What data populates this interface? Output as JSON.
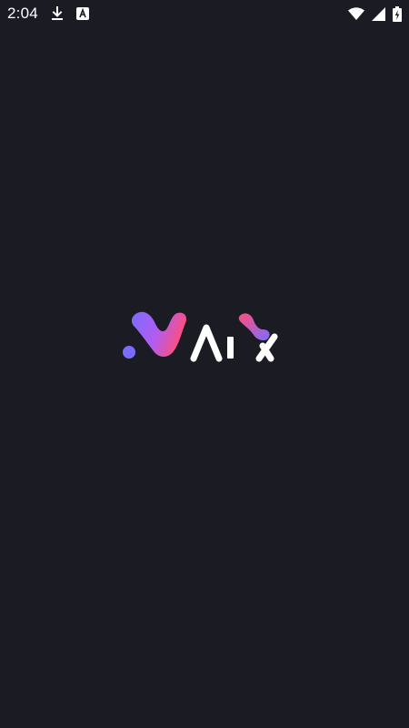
{
  "status_bar": {
    "time": "2:04",
    "icons": {
      "download": "download-icon",
      "app_notification": "app-notification-icon",
      "wifi": "wifi-icon",
      "cell_signal": "cell-signal-icon",
      "battery": "battery-charging-icon"
    }
  },
  "splash": {
    "logo_text": "Aix",
    "colors": {
      "background": "#1b1b24",
      "gradient_start": "#7b6cff",
      "gradient_end": "#ff4f7a",
      "word": "#ffffff"
    }
  }
}
